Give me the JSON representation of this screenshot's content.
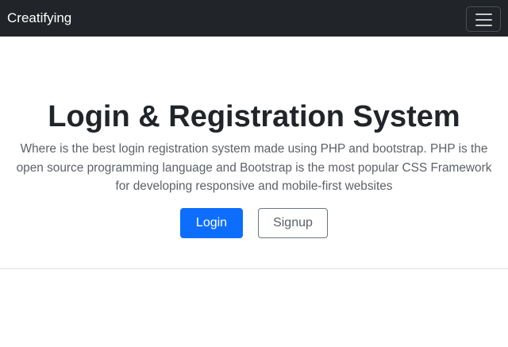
{
  "navbar": {
    "brand": "Creatifying",
    "toggler_icon": "hamburger-menu-icon",
    "background": "#212529"
  },
  "hero": {
    "title": "Login & Registration System",
    "lead": "Where is the best login registration system made using PHP and bootstrap. PHP is the open source programming language and Bootstrap is the most popular CSS Framework for developing responsive and mobile-first websites",
    "login_label": "Login",
    "signup_label": "Signup"
  },
  "colors": {
    "primary": "#0d6efd",
    "secondary": "#6c757d",
    "text": "#212529"
  }
}
